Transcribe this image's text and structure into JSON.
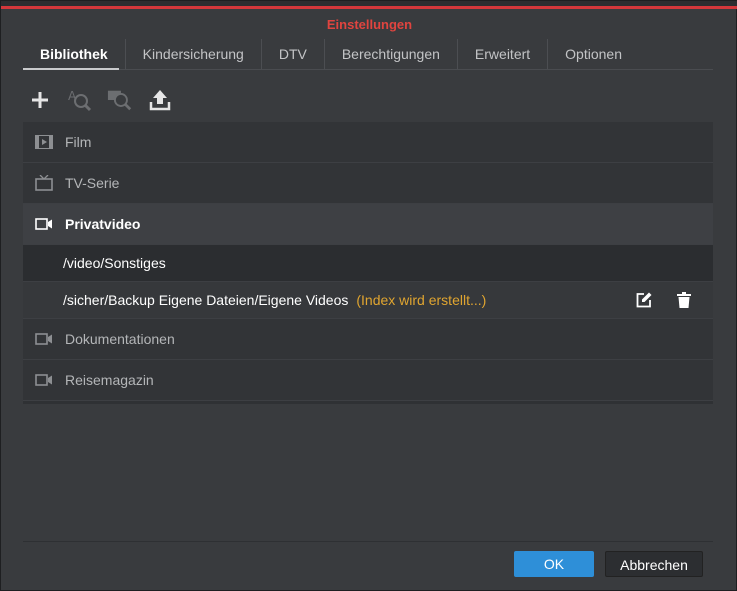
{
  "dialog": {
    "title": "Einstellungen"
  },
  "tabs": [
    {
      "label": "Bibliothek",
      "active": true
    },
    {
      "label": "Kindersicherung"
    },
    {
      "label": "DTV"
    },
    {
      "label": "Berechtigungen"
    },
    {
      "label": "Erweitert"
    },
    {
      "label": "Optionen"
    }
  ],
  "toolbar": {
    "icons": [
      "plus-icon",
      "search-text-icon",
      "search-video-icon",
      "upload-icon"
    ]
  },
  "library": {
    "film": {
      "label": "Film",
      "icon": "film-icon"
    },
    "tv": {
      "label": "TV-Serie",
      "icon": "tv-icon"
    },
    "private": {
      "label": "Privatvideo",
      "icon": "video-camera-icon",
      "folders": [
        {
          "path": "/video/Sonstiges"
        },
        {
          "path": "/sicher/Backup Eigene Dateien/Eigene Videos",
          "status": "(Index wird erstellt...)"
        }
      ]
    },
    "docs": {
      "label": "Dokumentationen",
      "icon": "video-camera-icon"
    },
    "travel": {
      "label": "Reisemagazin",
      "icon": "video-camera-icon"
    }
  },
  "footer": {
    "ok_label": "OK",
    "cancel_label": "Abbrechen"
  },
  "colors": {
    "accent": "#d3373b",
    "title": "#e0443f",
    "status": "#e0a530",
    "primary": "#2e8fd8"
  }
}
